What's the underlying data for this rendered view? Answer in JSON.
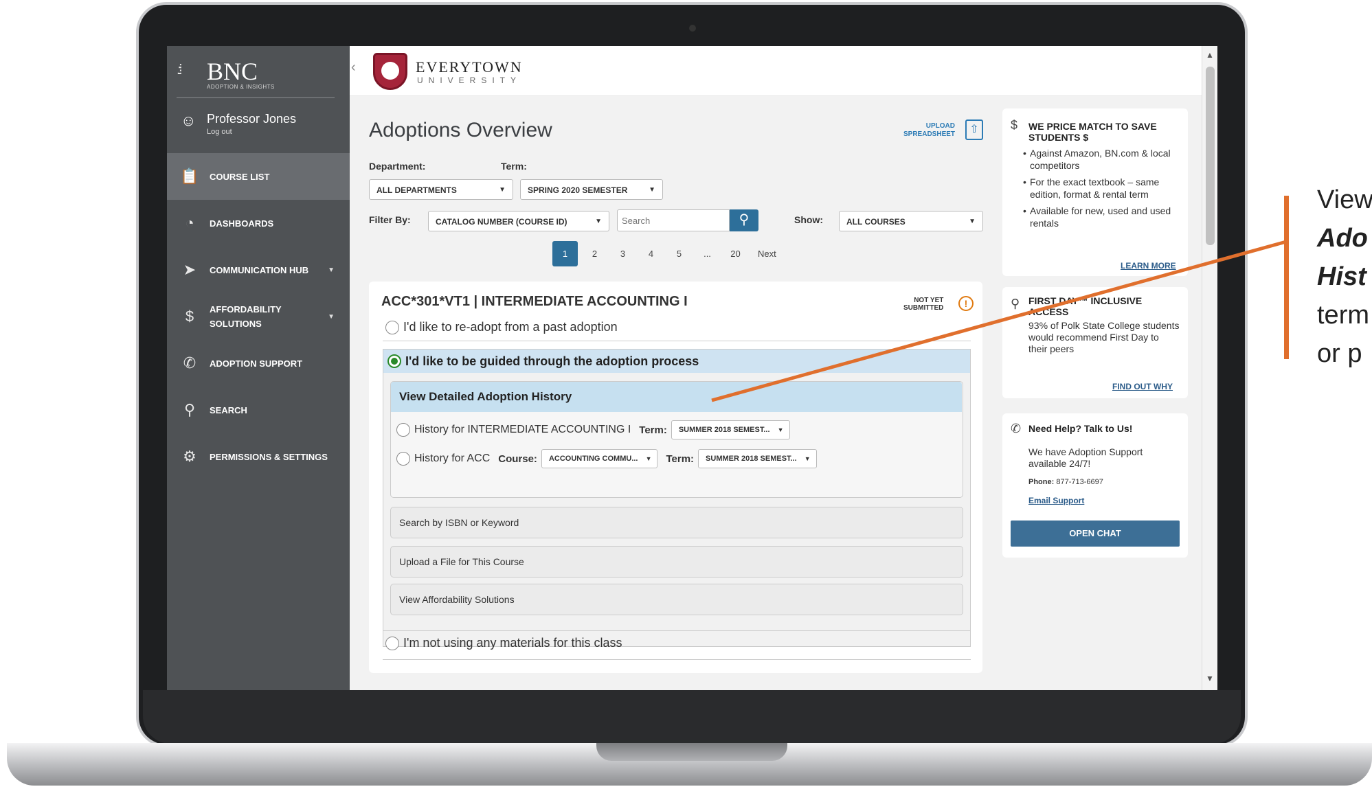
{
  "sidebar": {
    "brand": "BNC",
    "brand_tag": "ADOPTION & INSIGHTS",
    "user_name": "Professor Jones",
    "logout": "Log out",
    "items": [
      {
        "label": "COURSE LIST",
        "icon": "clipboard-icon"
      },
      {
        "label": "DASHBOARDS",
        "icon": "pie-chart-icon"
      },
      {
        "label": "COMMUNICATION HUB",
        "icon": "paper-plane-icon"
      },
      {
        "label": "AFFORDABILITY SOLUTIONS",
        "icon": "dollar-icon"
      },
      {
        "label": "ADOPTION SUPPORT",
        "icon": "phone-icon"
      },
      {
        "label": "SEARCH",
        "icon": "search-icon"
      },
      {
        "label": "PERMISSIONS & SETTINGS",
        "icon": "gear-icon"
      }
    ]
  },
  "header": {
    "university_name": "EVERYTOWN",
    "university_sub": "UNIVERSITY"
  },
  "main": {
    "title": "Adoptions Overview",
    "upload_label_1": "UPLOAD",
    "upload_label_2": "SPREADSHEET",
    "department_label": "Department:",
    "department_value": "ALL DEPARTMENTS",
    "term_label": "Term:",
    "term_value": "SPRING 2020 SEMESTER",
    "filter_label": "Filter By:",
    "filter_value": "CATALOG NUMBER (COURSE ID)",
    "search_placeholder": "Search",
    "show_label": "Show:",
    "show_value": "ALL COURSES",
    "pagination": [
      "1",
      "2",
      "3",
      "4",
      "5",
      "...",
      "20"
    ],
    "next_label": "Next"
  },
  "course": {
    "title": "ACC*301*VT1  | INTERMEDIATE ACCOUNTING I",
    "status_line1": "NOT YET",
    "status_line2": "SUBMITTED",
    "status_icon": "!",
    "option_readopt": "I'd like to re-adopt from a past adoption",
    "option_guided": "I'd like to be guided through the adoption process",
    "history_header": "View Detailed Adoption History",
    "history_course": "History for INTERMEDIATE ACCOUNTING I",
    "history_course_term_label": "Term:",
    "history_course_term_value": "SUMMER 2018 SEMEST...",
    "history_dept": "History for ACC",
    "history_dept_course_label": "Course:",
    "history_dept_course_value": "ACCOUNTING COMMU...",
    "history_dept_term_label": "Term:",
    "history_dept_term_value": "SUMMER 2018 SEMEST...",
    "search_isbn": "Search by ISBN or Keyword",
    "upload_file": "Upload a File for This Course",
    "view_affordability": "View Affordability Solutions",
    "option_none": "I'm not using any materials for this class"
  },
  "right": {
    "price_title": "WE PRICE MATCH TO SAVE STUDENTS $",
    "price_bullets": [
      "Against Amazon, BN.com & local competitors",
      "For the exact textbook – same edition, format & rental term",
      "Available for new, used and used rentals"
    ],
    "price_link": "LEARN MORE",
    "firstday_title": "FIRST DAY™ INCLUSIVE ACCESS",
    "firstday_text": "93% of Polk State College students would recommend First Day to their peers",
    "firstday_link": "FIND OUT WHY",
    "help_title": "Need Help? Talk to Us!",
    "help_text": "We have Adoption Support available 24/7!",
    "phone_label": "Phone:",
    "phone_value": "877-713-6697",
    "email_link": "Email Support",
    "chat_button": "OPEN CHAT"
  },
  "annotation": {
    "line1": "View",
    "line2": "Ado",
    "line3": "Hist",
    "line4": "term",
    "line5": "or p",
    "color": "#e06f2d"
  }
}
